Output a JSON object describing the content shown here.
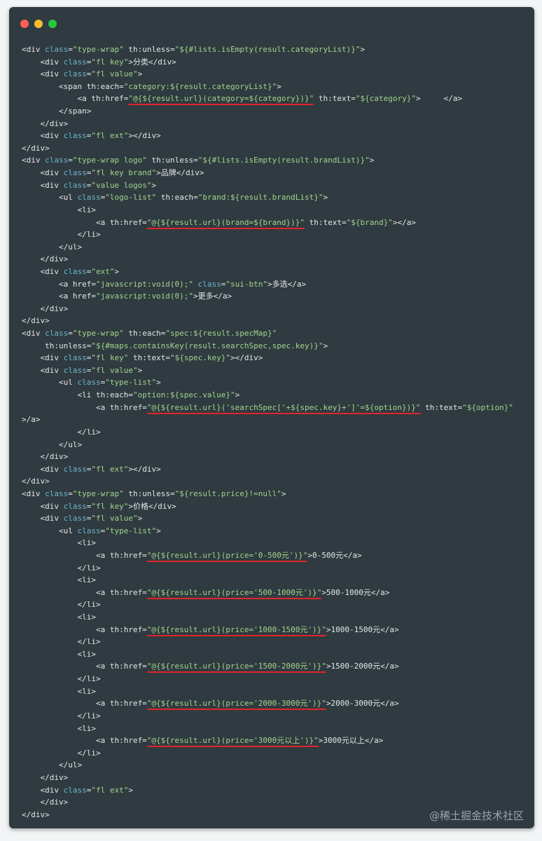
{
  "window": {
    "dot_colors": {
      "close": "#ff5f56",
      "minimize": "#ffbd2e",
      "zoom": "#27c93f"
    }
  },
  "code_lines": [
    [
      [
        "p",
        "<div "
      ],
      [
        "a",
        "class"
      ],
      [
        "p",
        "="
      ],
      [
        "s",
        "\"type-wrap\""
      ],
      [
        "p",
        " th:unless="
      ],
      [
        "s",
        "\"${#lists.isEmpty(result.categoryList)}\""
      ],
      [
        "p",
        ">"
      ]
    ],
    [
      [
        "p",
        "    <div "
      ],
      [
        "a",
        "class"
      ],
      [
        "p",
        "="
      ],
      [
        "s",
        "\"fl key\""
      ],
      [
        "p",
        ">分类</div>"
      ]
    ],
    [
      [
        "p",
        "    <div "
      ],
      [
        "a",
        "class"
      ],
      [
        "p",
        "="
      ],
      [
        "s",
        "\"fl value\""
      ],
      [
        "p",
        ">"
      ]
    ],
    [
      [
        "p",
        "        <span th:each="
      ],
      [
        "s",
        "\"category:${result.categoryList}\""
      ],
      [
        "p",
        ">"
      ]
    ],
    [
      [
        "p",
        "            <a th:href="
      ],
      [
        "s",
        "\"@{${result.url}(category=${category})}\""
      ],
      [
        "p",
        " th:text="
      ],
      [
        "s",
        "\"${category}\""
      ],
      [
        "p",
        ">     </a>"
      ]
    ],
    [
      [
        "p",
        "        </span>"
      ]
    ],
    [
      [
        "p",
        "    </div>"
      ]
    ],
    [
      [
        "p",
        "    <div "
      ],
      [
        "a",
        "class"
      ],
      [
        "p",
        "="
      ],
      [
        "s",
        "\"fl ext\""
      ],
      [
        "p",
        "></div>"
      ]
    ],
    [
      [
        "p",
        "</div>"
      ]
    ],
    [
      [
        "p",
        "<div "
      ],
      [
        "a",
        "class"
      ],
      [
        "p",
        "="
      ],
      [
        "s",
        "\"type-wrap logo\""
      ],
      [
        "p",
        " th:unless="
      ],
      [
        "s",
        "\"${#lists.isEmpty(result.brandList)}\""
      ],
      [
        "p",
        ">"
      ]
    ],
    [
      [
        "p",
        "    <div "
      ],
      [
        "a",
        "class"
      ],
      [
        "p",
        "="
      ],
      [
        "s",
        "\"fl key brand\""
      ],
      [
        "p",
        ">品牌</div>"
      ]
    ],
    [
      [
        "p",
        "    <div "
      ],
      [
        "a",
        "class"
      ],
      [
        "p",
        "="
      ],
      [
        "s",
        "\"value logos\""
      ],
      [
        "p",
        ">"
      ]
    ],
    [
      [
        "p",
        "        <ul "
      ],
      [
        "a",
        "class"
      ],
      [
        "p",
        "="
      ],
      [
        "s",
        "\"logo-list\""
      ],
      [
        "p",
        " th:each="
      ],
      [
        "s",
        "\"brand:${result.brandList}\""
      ],
      [
        "p",
        ">"
      ]
    ],
    [
      [
        "p",
        "            <li>"
      ]
    ],
    [
      [
        "p",
        "                <a th:href="
      ],
      [
        "s",
        "\"@{${result.url}(brand=${brand})}\""
      ],
      [
        "p",
        " th:text="
      ],
      [
        "s",
        "\"${brand}\""
      ],
      [
        "p",
        "></a>"
      ]
    ],
    [
      [
        "p",
        "            </li>"
      ]
    ],
    [
      [
        "p",
        "        </ul>"
      ]
    ],
    [
      [
        "p",
        "    </div>"
      ]
    ],
    [
      [
        "p",
        "    <div "
      ],
      [
        "a",
        "class"
      ],
      [
        "p",
        "="
      ],
      [
        "s",
        "\"ext\""
      ],
      [
        "p",
        ">"
      ]
    ],
    [
      [
        "p",
        "        <a href="
      ],
      [
        "s",
        "\"javascript:void(0);\""
      ],
      [
        "p",
        " "
      ],
      [
        "a",
        "class"
      ],
      [
        "p",
        "="
      ],
      [
        "s",
        "\"sui-btn\""
      ],
      [
        "p",
        ">多选</a>"
      ]
    ],
    [
      [
        "p",
        "        <a href="
      ],
      [
        "s",
        "\"javascript:void(0);\""
      ],
      [
        "p",
        ">更多</a>"
      ]
    ],
    [
      [
        "p",
        "    </div>"
      ]
    ],
    [
      [
        "p",
        "</div>"
      ]
    ],
    [
      [
        "p",
        "<div "
      ],
      [
        "a",
        "class"
      ],
      [
        "p",
        "="
      ],
      [
        "s",
        "\"type-wrap\""
      ],
      [
        "p",
        " th:each="
      ],
      [
        "s",
        "\"spec:${result.specMap}\""
      ]
    ],
    [
      [
        "p",
        "     th:unless="
      ],
      [
        "s",
        "\"${#maps.containsKey(result.searchSpec,spec.key)}\""
      ],
      [
        "p",
        ">"
      ]
    ],
    [
      [
        "p",
        "    <div "
      ],
      [
        "a",
        "class"
      ],
      [
        "p",
        "="
      ],
      [
        "s",
        "\"fl key\""
      ],
      [
        "p",
        " th:text="
      ],
      [
        "s",
        "\"${spec.key}\""
      ],
      [
        "p",
        "></div>"
      ]
    ],
    [
      [
        "p",
        "    <div "
      ],
      [
        "a",
        "class"
      ],
      [
        "p",
        "="
      ],
      [
        "s",
        "\"fl value\""
      ],
      [
        "p",
        ">"
      ]
    ],
    [
      [
        "p",
        "        <ul "
      ],
      [
        "a",
        "class"
      ],
      [
        "p",
        "="
      ],
      [
        "s",
        "\"type-list\""
      ],
      [
        "p",
        ">"
      ]
    ],
    [
      [
        "p",
        "            <li th:each="
      ],
      [
        "s",
        "\"option:${spec.value}\""
      ],
      [
        "p",
        ">"
      ]
    ],
    [
      [
        "p",
        "                <a th:href="
      ],
      [
        "s",
        "\"@{${result.url}('searchSpec['+${spec.key}+']'=${option})}\""
      ],
      [
        "p",
        " th:text="
      ],
      [
        "s",
        "\"${option}\""
      ]
    ],
    [
      [
        "p",
        ">/a>"
      ]
    ],
    [
      [
        "p",
        "            </li>"
      ]
    ],
    [
      [
        "p",
        "        </ul>"
      ]
    ],
    [
      [
        "p",
        "    </div>"
      ]
    ],
    [
      [
        "p",
        "    <div "
      ],
      [
        "a",
        "class"
      ],
      [
        "p",
        "="
      ],
      [
        "s",
        "\"fl ext\""
      ],
      [
        "p",
        "></div>"
      ]
    ],
    [
      [
        "p",
        "</div>"
      ]
    ],
    [
      [
        "p",
        "<div "
      ],
      [
        "a",
        "class"
      ],
      [
        "p",
        "="
      ],
      [
        "s",
        "\"type-wrap\""
      ],
      [
        "p",
        " th:unless="
      ],
      [
        "s",
        "\"${result.price}!=null\""
      ],
      [
        "p",
        ">"
      ]
    ],
    [
      [
        "p",
        "    <div "
      ],
      [
        "a",
        "class"
      ],
      [
        "p",
        "="
      ],
      [
        "s",
        "\"fl key\""
      ],
      [
        "p",
        ">价格</div>"
      ]
    ],
    [
      [
        "p",
        "    <div "
      ],
      [
        "a",
        "class"
      ],
      [
        "p",
        "="
      ],
      [
        "s",
        "\"fl value\""
      ],
      [
        "p",
        ">"
      ]
    ],
    [
      [
        "p",
        "        <ul "
      ],
      [
        "a",
        "class"
      ],
      [
        "p",
        "="
      ],
      [
        "s",
        "\"type-list\""
      ],
      [
        "p",
        ">"
      ]
    ],
    [
      [
        "p",
        "            <li>"
      ]
    ],
    [
      [
        "p",
        "                <a th:href="
      ],
      [
        "s",
        "\"@{${result.url}(price='0-500元')}\""
      ],
      [
        "p",
        ">"
      ],
      [
        "t",
        "0-500"
      ],
      [
        "p",
        "元</a>"
      ]
    ],
    [
      [
        "p",
        "            </li>"
      ]
    ],
    [
      [
        "p",
        "            <li>"
      ]
    ],
    [
      [
        "p",
        "                <a th:href="
      ],
      [
        "s",
        "\"@{${result.url}(price='500-1000元')}\""
      ],
      [
        "p",
        ">"
      ],
      [
        "t",
        "500-1000"
      ],
      [
        "p",
        "元</a>"
      ]
    ],
    [
      [
        "p",
        "            </li>"
      ]
    ],
    [
      [
        "p",
        "            <li>"
      ]
    ],
    [
      [
        "p",
        "                <a th:href="
      ],
      [
        "s",
        "\"@{${result.url}(price='1000-1500元')}\""
      ],
      [
        "p",
        ">"
      ],
      [
        "t",
        "1000-1500"
      ],
      [
        "p",
        "元</a>"
      ]
    ],
    [
      [
        "p",
        "            </li>"
      ]
    ],
    [
      [
        "p",
        "            <li>"
      ]
    ],
    [
      [
        "p",
        "                <a th:href="
      ],
      [
        "s",
        "\"@{${result.url}(price='1500-2000元')}\""
      ],
      [
        "p",
        ">"
      ],
      [
        "t",
        "1500-2000"
      ],
      [
        "p",
        "元</a>"
      ]
    ],
    [
      [
        "p",
        "            </li>"
      ]
    ],
    [
      [
        "p",
        "            <li>"
      ]
    ],
    [
      [
        "p",
        "                <a th:href="
      ],
      [
        "s",
        "\"@{${result.url}(price='2000-3000元')}\""
      ],
      [
        "p",
        ">"
      ],
      [
        "t",
        "2000-3000"
      ],
      [
        "p",
        "元</a>"
      ]
    ],
    [
      [
        "p",
        "            </li>"
      ]
    ],
    [
      [
        "p",
        "            <li>"
      ]
    ],
    [
      [
        "p",
        "                <a th:href="
      ],
      [
        "s",
        "\"@{${result.url}(price='3000元以上')}\""
      ],
      [
        "p",
        ">"
      ],
      [
        "t",
        "3000"
      ],
      [
        "p",
        "元以上</a>"
      ]
    ],
    [
      [
        "p",
        "            </li>"
      ]
    ],
    [
      [
        "p",
        "        </ul>"
      ]
    ],
    [
      [
        "p",
        "    </div>"
      ]
    ],
    [
      [
        "p",
        "    <div "
      ],
      [
        "a",
        "class"
      ],
      [
        "p",
        "="
      ],
      [
        "s",
        "\"fl ext\""
      ],
      [
        "p",
        ">"
      ]
    ],
    [
      [
        "p",
        "    </div>"
      ]
    ],
    [
      [
        "p",
        "</div>"
      ]
    ]
  ],
  "underline_color": "#e1252a",
  "underlined_lines": [
    4,
    14,
    29,
    41,
    44,
    47,
    50,
    53,
    56
  ],
  "watermark": "@稀土掘金技术社区"
}
